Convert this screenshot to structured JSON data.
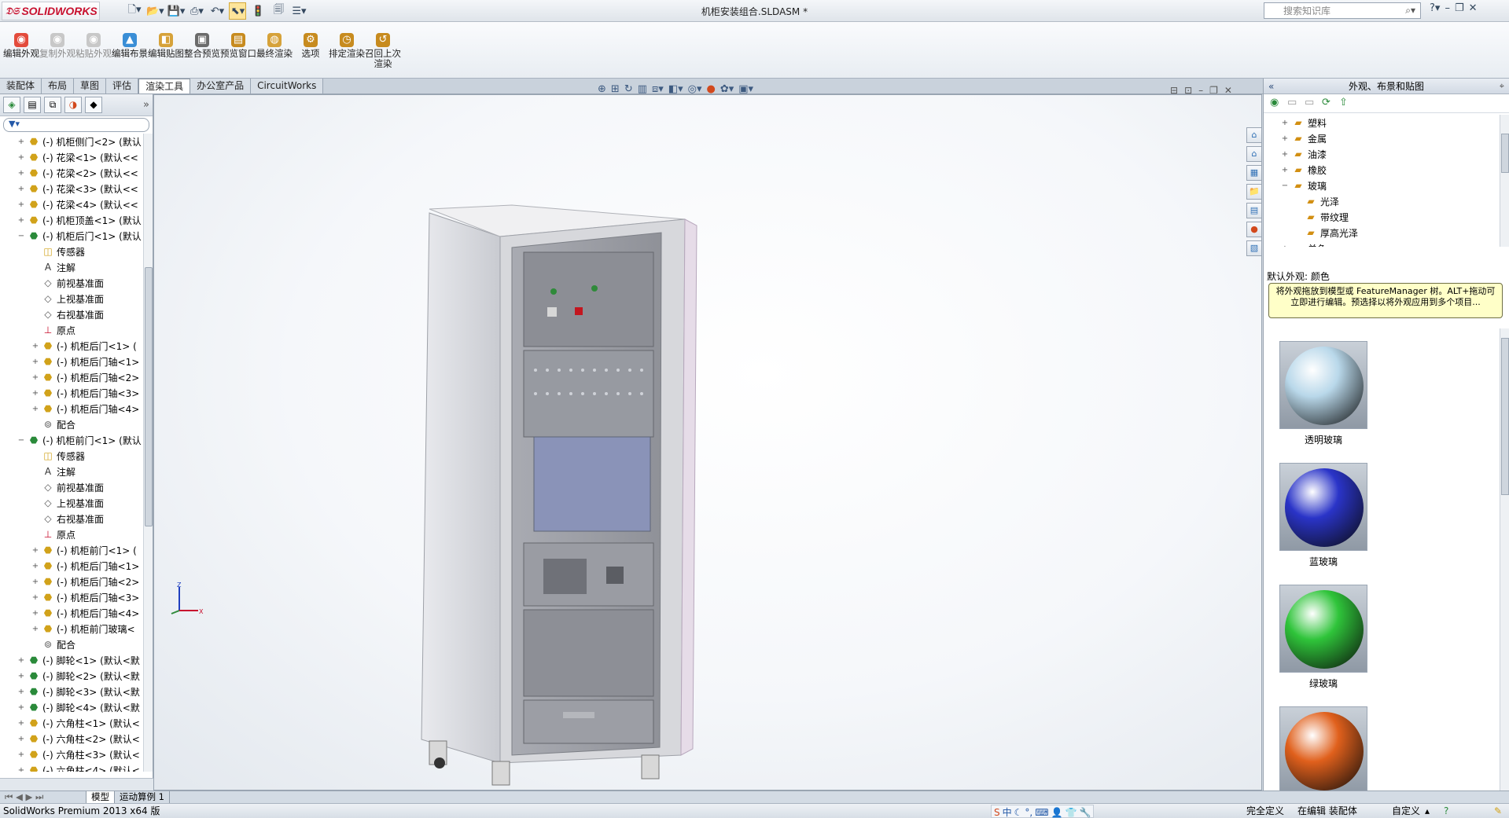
{
  "app": {
    "logo": "SOLIDWORKS",
    "document_title": "机柜安装组合.SLDASM *",
    "search_placeholder": "搜索知识库"
  },
  "ribbon": [
    {
      "label": "编辑外观",
      "enabled": true,
      "icon": "appearance-icon"
    },
    {
      "label": "复制外观",
      "enabled": false,
      "icon": "copy-appearance-icon"
    },
    {
      "label": "粘贴外观",
      "enabled": false,
      "icon": "paste-appearance-icon"
    },
    {
      "label": "编辑布景",
      "enabled": true,
      "icon": "scene-icon"
    },
    {
      "label": "编辑贴图",
      "enabled": true,
      "icon": "decal-icon"
    },
    {
      "label": "整合预览",
      "enabled": true,
      "icon": "integrated-preview-icon"
    },
    {
      "label": "预览窗口",
      "enabled": true,
      "icon": "preview-window-icon"
    },
    {
      "label": "最终渲染",
      "enabled": true,
      "icon": "final-render-icon"
    },
    {
      "label": "选项",
      "enabled": true,
      "icon": "options-icon"
    },
    {
      "label": "排定渲染",
      "enabled": true,
      "icon": "schedule-render-icon"
    },
    {
      "label": "召回上次渲染",
      "enabled": true,
      "icon": "recall-render-icon"
    }
  ],
  "tabs": [
    "装配体",
    "布局",
    "草图",
    "评估",
    "渲染工具",
    "办公室产品",
    "CircuitWorks"
  ],
  "active_tab": "渲染工具",
  "tree": [
    {
      "label": "(-) 机柜侧门<2> (默认",
      "level": 1,
      "type": "part",
      "expander": "+"
    },
    {
      "label": "(-) 花梁<1> (默认<<",
      "level": 1,
      "type": "part",
      "expander": "+"
    },
    {
      "label": "(-) 花梁<2> (默认<<",
      "level": 1,
      "type": "part",
      "expander": "+"
    },
    {
      "label": "(-) 花梁<3> (默认<<",
      "level": 1,
      "type": "part",
      "expander": "+"
    },
    {
      "label": "(-) 花梁<4> (默认<<",
      "level": 1,
      "type": "part",
      "expander": "+"
    },
    {
      "label": "(-) 机柜顶盖<1> (默认",
      "level": 1,
      "type": "part",
      "expander": "+"
    },
    {
      "label": "(-) 机柜后门<1> (默认",
      "level": 1,
      "type": "asm",
      "expander": "−"
    },
    {
      "label": "传感器",
      "level": 2,
      "type": "sensor",
      "expander": ""
    },
    {
      "label": "注解",
      "level": 2,
      "type": "note",
      "expander": ""
    },
    {
      "label": "前视基准面",
      "level": 2,
      "type": "plane",
      "expander": ""
    },
    {
      "label": "上视基准面",
      "level": 2,
      "type": "plane",
      "expander": ""
    },
    {
      "label": "右视基准面",
      "level": 2,
      "type": "plane",
      "expander": ""
    },
    {
      "label": "原点",
      "level": 2,
      "type": "origin",
      "expander": ""
    },
    {
      "label": "(-) 机柜后门<1> (",
      "level": 2,
      "type": "part",
      "expander": "+"
    },
    {
      "label": "(-) 机柜后门轴<1>",
      "level": 2,
      "type": "part",
      "expander": "+"
    },
    {
      "label": "(-) 机柜后门轴<2>",
      "level": 2,
      "type": "part",
      "expander": "+"
    },
    {
      "label": "(-) 机柜后门轴<3>",
      "level": 2,
      "type": "part",
      "expander": "+"
    },
    {
      "label": "(-) 机柜后门轴<4>",
      "level": 2,
      "type": "part",
      "expander": "+"
    },
    {
      "label": "配合",
      "level": 2,
      "type": "mate",
      "expander": ""
    },
    {
      "label": "(-) 机柜前门<1> (默认",
      "level": 1,
      "type": "asm",
      "expander": "−"
    },
    {
      "label": "传感器",
      "level": 2,
      "type": "sensor",
      "expander": ""
    },
    {
      "label": "注解",
      "level": 2,
      "type": "note",
      "expander": ""
    },
    {
      "label": "前视基准面",
      "level": 2,
      "type": "plane",
      "expander": ""
    },
    {
      "label": "上视基准面",
      "level": 2,
      "type": "plane",
      "expander": ""
    },
    {
      "label": "右视基准面",
      "level": 2,
      "type": "plane",
      "expander": ""
    },
    {
      "label": "原点",
      "level": 2,
      "type": "origin",
      "expander": ""
    },
    {
      "label": "(-) 机柜前门<1> (",
      "level": 2,
      "type": "part",
      "expander": "+"
    },
    {
      "label": "(-) 机柜后门轴<1>",
      "level": 2,
      "type": "part",
      "expander": "+"
    },
    {
      "label": "(-) 机柜后门轴<2>",
      "level": 2,
      "type": "part",
      "expander": "+"
    },
    {
      "label": "(-) 机柜后门轴<3>",
      "level": 2,
      "type": "part",
      "expander": "+"
    },
    {
      "label": "(-) 机柜后门轴<4>",
      "level": 2,
      "type": "part",
      "expander": "+"
    },
    {
      "label": "(-) 机柜前门玻璃<",
      "level": 2,
      "type": "part",
      "expander": "+"
    },
    {
      "label": "配合",
      "level": 2,
      "type": "mate",
      "expander": ""
    },
    {
      "label": "(-) 脚轮<1> (默认<默",
      "level": 1,
      "type": "asm",
      "expander": "+"
    },
    {
      "label": "(-) 脚轮<2> (默认<默",
      "level": 1,
      "type": "asm",
      "expander": "+"
    },
    {
      "label": "(-) 脚轮<3> (默认<默",
      "level": 1,
      "type": "asm",
      "expander": "+"
    },
    {
      "label": "(-) 脚轮<4> (默认<默",
      "level": 1,
      "type": "asm",
      "expander": "+"
    },
    {
      "label": "(-) 六角柱<1> (默认<",
      "level": 1,
      "type": "part",
      "expander": "+"
    },
    {
      "label": "(-) 六角柱<2> (默认<",
      "level": 1,
      "type": "part",
      "expander": "+"
    },
    {
      "label": "(-) 六角柱<3> (默认<",
      "level": 1,
      "type": "part",
      "expander": "+"
    },
    {
      "label": "(-) 六角柱<4> (默认<",
      "level": 1,
      "type": "part",
      "expander": "+"
    }
  ],
  "bottom_tabs": [
    "模型",
    "运动算例 1"
  ],
  "status": {
    "product": "SolidWorks Premium 2013 x64 版",
    "definition": "完全定义",
    "editing": "在编辑 装配体",
    "custom": "自定义"
  },
  "ime": {
    "label": "中"
  },
  "task_pane": {
    "title": "外观、布景和贴图",
    "library": [
      {
        "label": "塑料",
        "level": 1,
        "expander": "+"
      },
      {
        "label": "金属",
        "level": 1,
        "expander": "+"
      },
      {
        "label": "油漆",
        "level": 1,
        "expander": "+"
      },
      {
        "label": "橡胶",
        "level": 1,
        "expander": "+"
      },
      {
        "label": "玻璃",
        "level": 1,
        "expander": "−"
      },
      {
        "label": "光泽",
        "level": 2,
        "expander": ""
      },
      {
        "label": "带纹理",
        "level": 2,
        "expander": ""
      },
      {
        "label": "厚高光泽",
        "level": 2,
        "expander": ""
      },
      {
        "label": "单色",
        "level": 1,
        "expander": "+"
      }
    ],
    "default_appearance": "默认外观: 颜色",
    "hint": "将外观拖放到模型或 FeatureManager 树。ALT+拖动可立即进行编辑。预选择以将外观应用到多个项目...",
    "swatches": [
      {
        "label": "透明玻璃",
        "color": "#b9d8ea"
      },
      {
        "label": "蓝玻璃",
        "color": "#2a34c8"
      },
      {
        "label": "绿玻璃",
        "color": "#2fc43a"
      },
      {
        "label": "",
        "color": "#e0601c"
      }
    ]
  },
  "colors": {
    "accent": "#c8102e",
    "selection": "#fde59a"
  }
}
